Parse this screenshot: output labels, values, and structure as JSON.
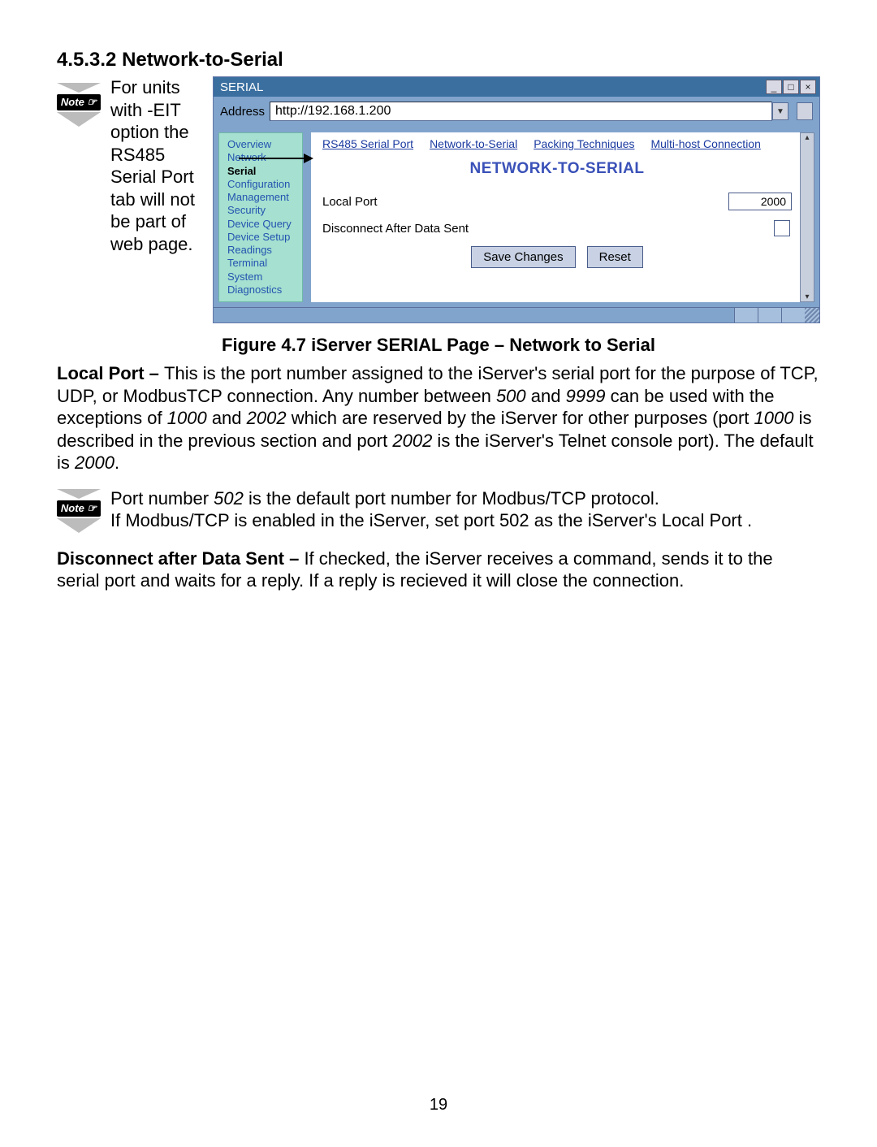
{
  "section_heading": "4.5.3.2  Network-to-Serial",
  "note_label": "Note ☞",
  "sidenote": "For units with -EIT option the RS485 Serial Port tab will not be part of web page.",
  "screenshot": {
    "window_title": "SERIAL",
    "window_buttons": {
      "min": "_",
      "max": "□",
      "close": "×"
    },
    "address_label": "Address",
    "address_value": "http://192.168.1.200",
    "nav_items": [
      "Overview",
      "Network",
      "Serial",
      "Configuration",
      "Management",
      "Security",
      "Device Query",
      "Device Setup",
      "Readings",
      "Terminal",
      "System",
      "Diagnostics"
    ],
    "nav_selected": "Serial",
    "tabs": [
      "RS485 Serial Port",
      "Network-to-Serial",
      "Packing Techniques",
      "Multi-host Connection"
    ],
    "panel_title": "NETWORK-TO-SERIAL",
    "field_local_port_label": "Local Port",
    "field_local_port_value": "2000",
    "field_disconnect_label": "Disconnect After Data Sent",
    "btn_save": "Save Changes",
    "btn_reset": "Reset"
  },
  "figure_caption": "Figure 4.7  iServer SERIAL Page – Network to Serial",
  "para1_lead": "Local Port – ",
  "para1_a": "This is the port number assigned to the iServer's serial port for the purpose of TCP, UDP, or ModbusTCP connection. Any number between ",
  "para1_b": "500",
  "para1_c": " and ",
  "para1_d": "9999",
  "para1_e": " can be used with the exceptions of ",
  "para1_f": "1000",
  "para1_g": " and ",
  "para1_h": "2002",
  "para1_i": " which are reserved by the iServer for other purposes (port ",
  "para1_j": "1000",
  "para1_k": " is described in the previous section and port ",
  "para1_l": "2002",
  "para1_m": " is the iServer's Telnet console port). The default is ",
  "para1_n": "2000",
  "para1_o": ".",
  "note2_a": "Port number ",
  "note2_b": "502",
  "note2_c": " is the default port number for Modbus/TCP protocol.",
  "note2_d": "If Modbus/TCP is enabled in the iServer, set port 502 as the iServer's Local Port .",
  "para2_lead": "Disconnect after Data Sent – ",
  "para2_body": "If checked, the iServer receives a command, sends it to the serial port and waits for a reply. If a reply is recieved it will close the connection.",
  "page_number": "19"
}
